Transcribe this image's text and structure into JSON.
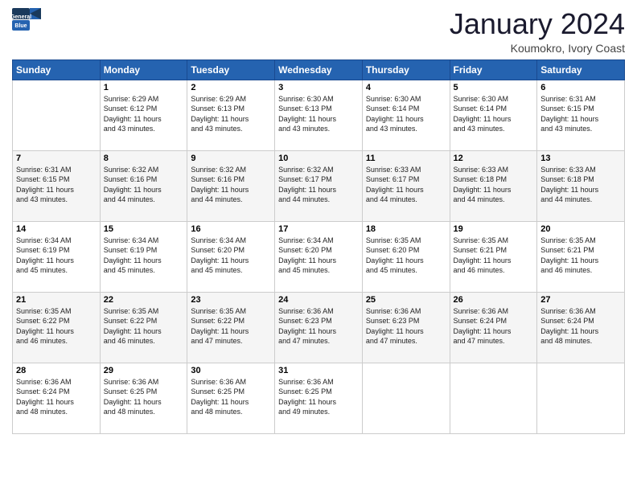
{
  "header": {
    "logo_general": "General",
    "logo_blue": "Blue",
    "month_title": "January 2024",
    "location": "Koumokro, Ivory Coast"
  },
  "weekdays": [
    "Sunday",
    "Monday",
    "Tuesday",
    "Wednesday",
    "Thursday",
    "Friday",
    "Saturday"
  ],
  "weeks": [
    [
      {
        "day": "",
        "sunrise": "",
        "sunset": "",
        "daylight": ""
      },
      {
        "day": "1",
        "sunrise": "Sunrise: 6:29 AM",
        "sunset": "Sunset: 6:12 PM",
        "daylight": "Daylight: 11 hours and 43 minutes."
      },
      {
        "day": "2",
        "sunrise": "Sunrise: 6:29 AM",
        "sunset": "Sunset: 6:13 PM",
        "daylight": "Daylight: 11 hours and 43 minutes."
      },
      {
        "day": "3",
        "sunrise": "Sunrise: 6:30 AM",
        "sunset": "Sunset: 6:13 PM",
        "daylight": "Daylight: 11 hours and 43 minutes."
      },
      {
        "day": "4",
        "sunrise": "Sunrise: 6:30 AM",
        "sunset": "Sunset: 6:14 PM",
        "daylight": "Daylight: 11 hours and 43 minutes."
      },
      {
        "day": "5",
        "sunrise": "Sunrise: 6:30 AM",
        "sunset": "Sunset: 6:14 PM",
        "daylight": "Daylight: 11 hours and 43 minutes."
      },
      {
        "day": "6",
        "sunrise": "Sunrise: 6:31 AM",
        "sunset": "Sunset: 6:15 PM",
        "daylight": "Daylight: 11 hours and 43 minutes."
      }
    ],
    [
      {
        "day": "7",
        "sunrise": "Sunrise: 6:31 AM",
        "sunset": "Sunset: 6:15 PM",
        "daylight": "Daylight: 11 hours and 43 minutes."
      },
      {
        "day": "8",
        "sunrise": "Sunrise: 6:32 AM",
        "sunset": "Sunset: 6:16 PM",
        "daylight": "Daylight: 11 hours and 44 minutes."
      },
      {
        "day": "9",
        "sunrise": "Sunrise: 6:32 AM",
        "sunset": "Sunset: 6:16 PM",
        "daylight": "Daylight: 11 hours and 44 minutes."
      },
      {
        "day": "10",
        "sunrise": "Sunrise: 6:32 AM",
        "sunset": "Sunset: 6:17 PM",
        "daylight": "Daylight: 11 hours and 44 minutes."
      },
      {
        "day": "11",
        "sunrise": "Sunrise: 6:33 AM",
        "sunset": "Sunset: 6:17 PM",
        "daylight": "Daylight: 11 hours and 44 minutes."
      },
      {
        "day": "12",
        "sunrise": "Sunrise: 6:33 AM",
        "sunset": "Sunset: 6:18 PM",
        "daylight": "Daylight: 11 hours and 44 minutes."
      },
      {
        "day": "13",
        "sunrise": "Sunrise: 6:33 AM",
        "sunset": "Sunset: 6:18 PM",
        "daylight": "Daylight: 11 hours and 44 minutes."
      }
    ],
    [
      {
        "day": "14",
        "sunrise": "Sunrise: 6:34 AM",
        "sunset": "Sunset: 6:19 PM",
        "daylight": "Daylight: 11 hours and 45 minutes."
      },
      {
        "day": "15",
        "sunrise": "Sunrise: 6:34 AM",
        "sunset": "Sunset: 6:19 PM",
        "daylight": "Daylight: 11 hours and 45 minutes."
      },
      {
        "day": "16",
        "sunrise": "Sunrise: 6:34 AM",
        "sunset": "Sunset: 6:20 PM",
        "daylight": "Daylight: 11 hours and 45 minutes."
      },
      {
        "day": "17",
        "sunrise": "Sunrise: 6:34 AM",
        "sunset": "Sunset: 6:20 PM",
        "daylight": "Daylight: 11 hours and 45 minutes."
      },
      {
        "day": "18",
        "sunrise": "Sunrise: 6:35 AM",
        "sunset": "Sunset: 6:20 PM",
        "daylight": "Daylight: 11 hours and 45 minutes."
      },
      {
        "day": "19",
        "sunrise": "Sunrise: 6:35 AM",
        "sunset": "Sunset: 6:21 PM",
        "daylight": "Daylight: 11 hours and 46 minutes."
      },
      {
        "day": "20",
        "sunrise": "Sunrise: 6:35 AM",
        "sunset": "Sunset: 6:21 PM",
        "daylight": "Daylight: 11 hours and 46 minutes."
      }
    ],
    [
      {
        "day": "21",
        "sunrise": "Sunrise: 6:35 AM",
        "sunset": "Sunset: 6:22 PM",
        "daylight": "Daylight: 11 hours and 46 minutes."
      },
      {
        "day": "22",
        "sunrise": "Sunrise: 6:35 AM",
        "sunset": "Sunset: 6:22 PM",
        "daylight": "Daylight: 11 hours and 46 minutes."
      },
      {
        "day": "23",
        "sunrise": "Sunrise: 6:35 AM",
        "sunset": "Sunset: 6:22 PM",
        "daylight": "Daylight: 11 hours and 47 minutes."
      },
      {
        "day": "24",
        "sunrise": "Sunrise: 6:36 AM",
        "sunset": "Sunset: 6:23 PM",
        "daylight": "Daylight: 11 hours and 47 minutes."
      },
      {
        "day": "25",
        "sunrise": "Sunrise: 6:36 AM",
        "sunset": "Sunset: 6:23 PM",
        "daylight": "Daylight: 11 hours and 47 minutes."
      },
      {
        "day": "26",
        "sunrise": "Sunrise: 6:36 AM",
        "sunset": "Sunset: 6:24 PM",
        "daylight": "Daylight: 11 hours and 47 minutes."
      },
      {
        "day": "27",
        "sunrise": "Sunrise: 6:36 AM",
        "sunset": "Sunset: 6:24 PM",
        "daylight": "Daylight: 11 hours and 48 minutes."
      }
    ],
    [
      {
        "day": "28",
        "sunrise": "Sunrise: 6:36 AM",
        "sunset": "Sunset: 6:24 PM",
        "daylight": "Daylight: 11 hours and 48 minutes."
      },
      {
        "day": "29",
        "sunrise": "Sunrise: 6:36 AM",
        "sunset": "Sunset: 6:25 PM",
        "daylight": "Daylight: 11 hours and 48 minutes."
      },
      {
        "day": "30",
        "sunrise": "Sunrise: 6:36 AM",
        "sunset": "Sunset: 6:25 PM",
        "daylight": "Daylight: 11 hours and 48 minutes."
      },
      {
        "day": "31",
        "sunrise": "Sunrise: 6:36 AM",
        "sunset": "Sunset: 6:25 PM",
        "daylight": "Daylight: 11 hours and 49 minutes."
      },
      {
        "day": "",
        "sunrise": "",
        "sunset": "",
        "daylight": ""
      },
      {
        "day": "",
        "sunrise": "",
        "sunset": "",
        "daylight": ""
      },
      {
        "day": "",
        "sunrise": "",
        "sunset": "",
        "daylight": ""
      }
    ]
  ]
}
